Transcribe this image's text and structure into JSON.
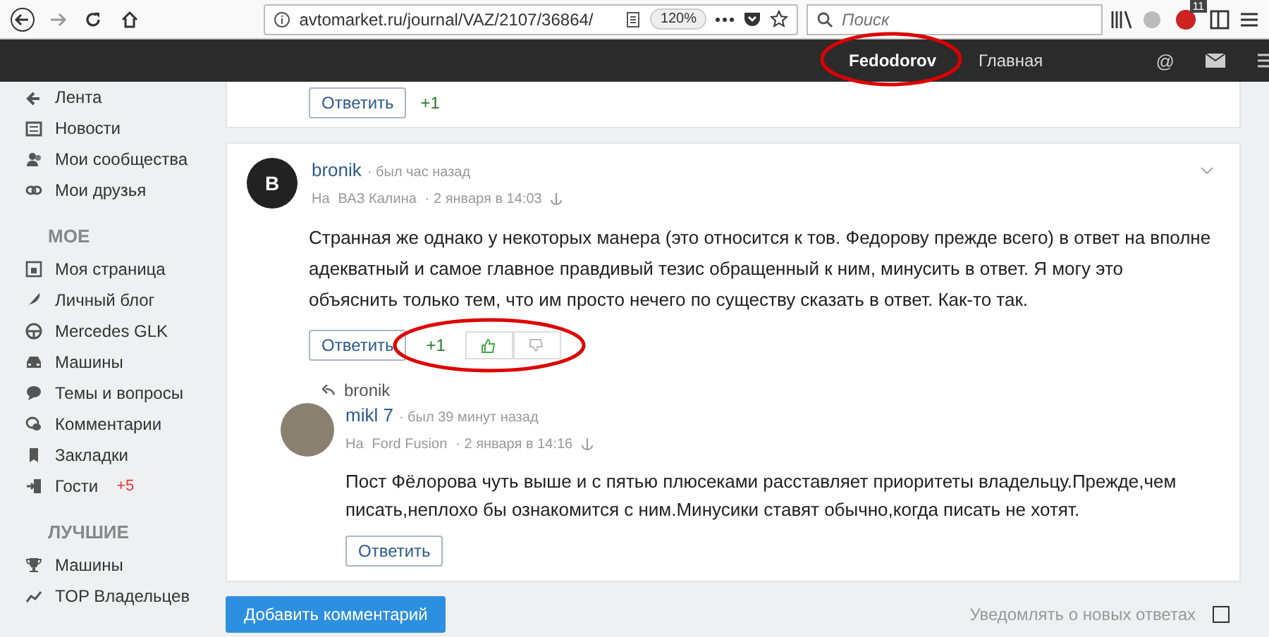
{
  "browser": {
    "url": "avtomarket.ru/journal/VAZ/2107/36864/",
    "zoom": "120%",
    "search_placeholder": "Поиск",
    "extension_badge": "11"
  },
  "site_header": {
    "user": "Fedodorov",
    "link": "Главная",
    "at": "@"
  },
  "sidebar": [
    {
      "items": [
        {
          "label": "Лента"
        },
        {
          "label": "Новости"
        },
        {
          "label": "Мои сообщества"
        },
        {
          "label": "Мои друзья"
        }
      ]
    },
    {
      "title": "МОЕ",
      "items": [
        {
          "label": "Моя страница"
        },
        {
          "label": "Личный блог"
        },
        {
          "label": "Mercedes GLK"
        },
        {
          "label": "Машины"
        },
        {
          "label": "Темы и вопросы"
        },
        {
          "label": "Комментарии"
        },
        {
          "label": "Закладки"
        },
        {
          "label": "Гости",
          "badge": "+5"
        }
      ]
    },
    {
      "title": "ЛУЧШИЕ",
      "items": [
        {
          "label": "Машины"
        },
        {
          "label": "TOP Владельцев"
        }
      ]
    }
  ],
  "previous_comment": {
    "reply_button": "Ответить",
    "score": "+1"
  },
  "comment": {
    "avatar_letter": "B",
    "author": "bronik",
    "status": "· был час назад",
    "car_prefix": "На",
    "car": "ВАЗ Калина",
    "date": "· 2 января в 14:03",
    "text": "Странная же однако у некоторых манера (это относится к тов. Федорову прежде всего) в ответ на вполне адекватный и самое главное правдивый тезис обращенный к ним, минусить в ответ. Я могу это объяснить только тем, что им просто нечего по существу сказать в ответ. Как-то так.",
    "reply_button": "Ответить",
    "score": "+1"
  },
  "reply": {
    "reply_to": "bronik",
    "author": "mikl 7",
    "status": "· был 39 минут назад",
    "car_prefix": "На",
    "car": "Ford Fusion",
    "date": "· 2 января в 14:16",
    "text": "Пост Фёлорова чуть выше и с пятью плюсеками расставляет приоритеты владельцу.Прежде,чем писать,неплохо бы ознакомится с ним.Минусики ставят обычно,когда писать не хотят.",
    "reply_button": "Ответить"
  },
  "footer": {
    "add_button": "Добавить комментарий",
    "notify_label": "Уведомлять о новых ответах",
    "notify_checked": false
  }
}
